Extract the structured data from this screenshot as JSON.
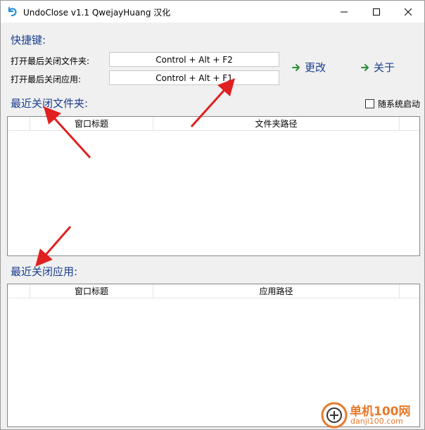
{
  "window": {
    "title": "UndoClose v1.1  QwejayHuang 汉化"
  },
  "hotkeys": {
    "section_title": "快捷键:",
    "folder_label": "打开最后关闭文件夹:",
    "folder_value": "Control + Alt + F2",
    "app_label": "打开最后关闭应用:",
    "app_value": "Control + Alt + F1",
    "change_label": "更改",
    "about_label": "关于"
  },
  "startup": {
    "label": "随系统启动",
    "checked": false
  },
  "folders": {
    "section_title": "最近关闭文件夹:",
    "columns": [
      "",
      "窗口标题",
      "文件夹路径"
    ],
    "rows": []
  },
  "apps": {
    "section_title": "最近关闭应用:",
    "columns": [
      "",
      "窗口标题",
      "应用路径"
    ],
    "rows": []
  },
  "watermark": {
    "text": "单机100网",
    "url": "danji100.com"
  },
  "colors": {
    "accent": "#1a3d8f",
    "arrow": "#e02020",
    "link_icon": "#2e8b3a",
    "watermark": "#e8792a"
  }
}
